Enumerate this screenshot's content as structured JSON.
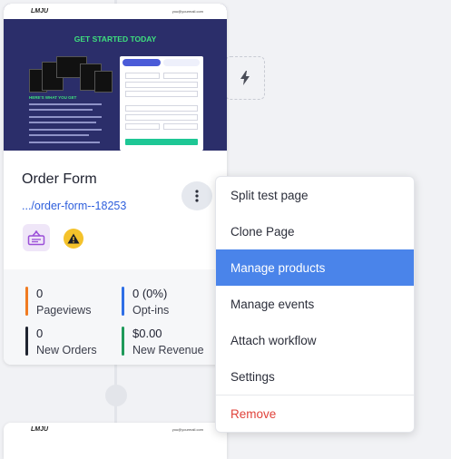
{
  "thumbnail": {
    "logo": "LMJU",
    "email": "you@yourmail.com",
    "headline": "GET STARTED TODAY",
    "subhead": "HERE'S WHAT YOU GET"
  },
  "card": {
    "title": "Order Form",
    "link": ".../order-form--18253"
  },
  "stats": [
    {
      "value": "0",
      "label": "Pageviews",
      "color": "#f07b22"
    },
    {
      "value": "0 (0%)",
      "label": "Opt-ins",
      "color": "#2f6fe6"
    },
    {
      "value": "0",
      "label": "New Orders",
      "color": "#1f2430"
    },
    {
      "value": "$0.00",
      "label": "New Revenue",
      "color": "#1f9a5a"
    }
  ],
  "menu": {
    "items": [
      {
        "label": "Split test page"
      },
      {
        "label": "Clone Page"
      },
      {
        "label": "Manage products"
      },
      {
        "label": "Manage events"
      },
      {
        "label": "Attach workflow"
      },
      {
        "label": "Settings"
      },
      {
        "label": "Remove"
      }
    ],
    "active_index": 2
  },
  "colors": {
    "accent": "#4a84ea",
    "link": "#2e5fdc",
    "danger": "#e0423a",
    "warning": "#f4c22b"
  },
  "icons": {
    "kebab": "vertical-dots-icon",
    "product": "products-icon",
    "warning": "warning-icon",
    "trigger": "lightning-bolt-icon"
  }
}
